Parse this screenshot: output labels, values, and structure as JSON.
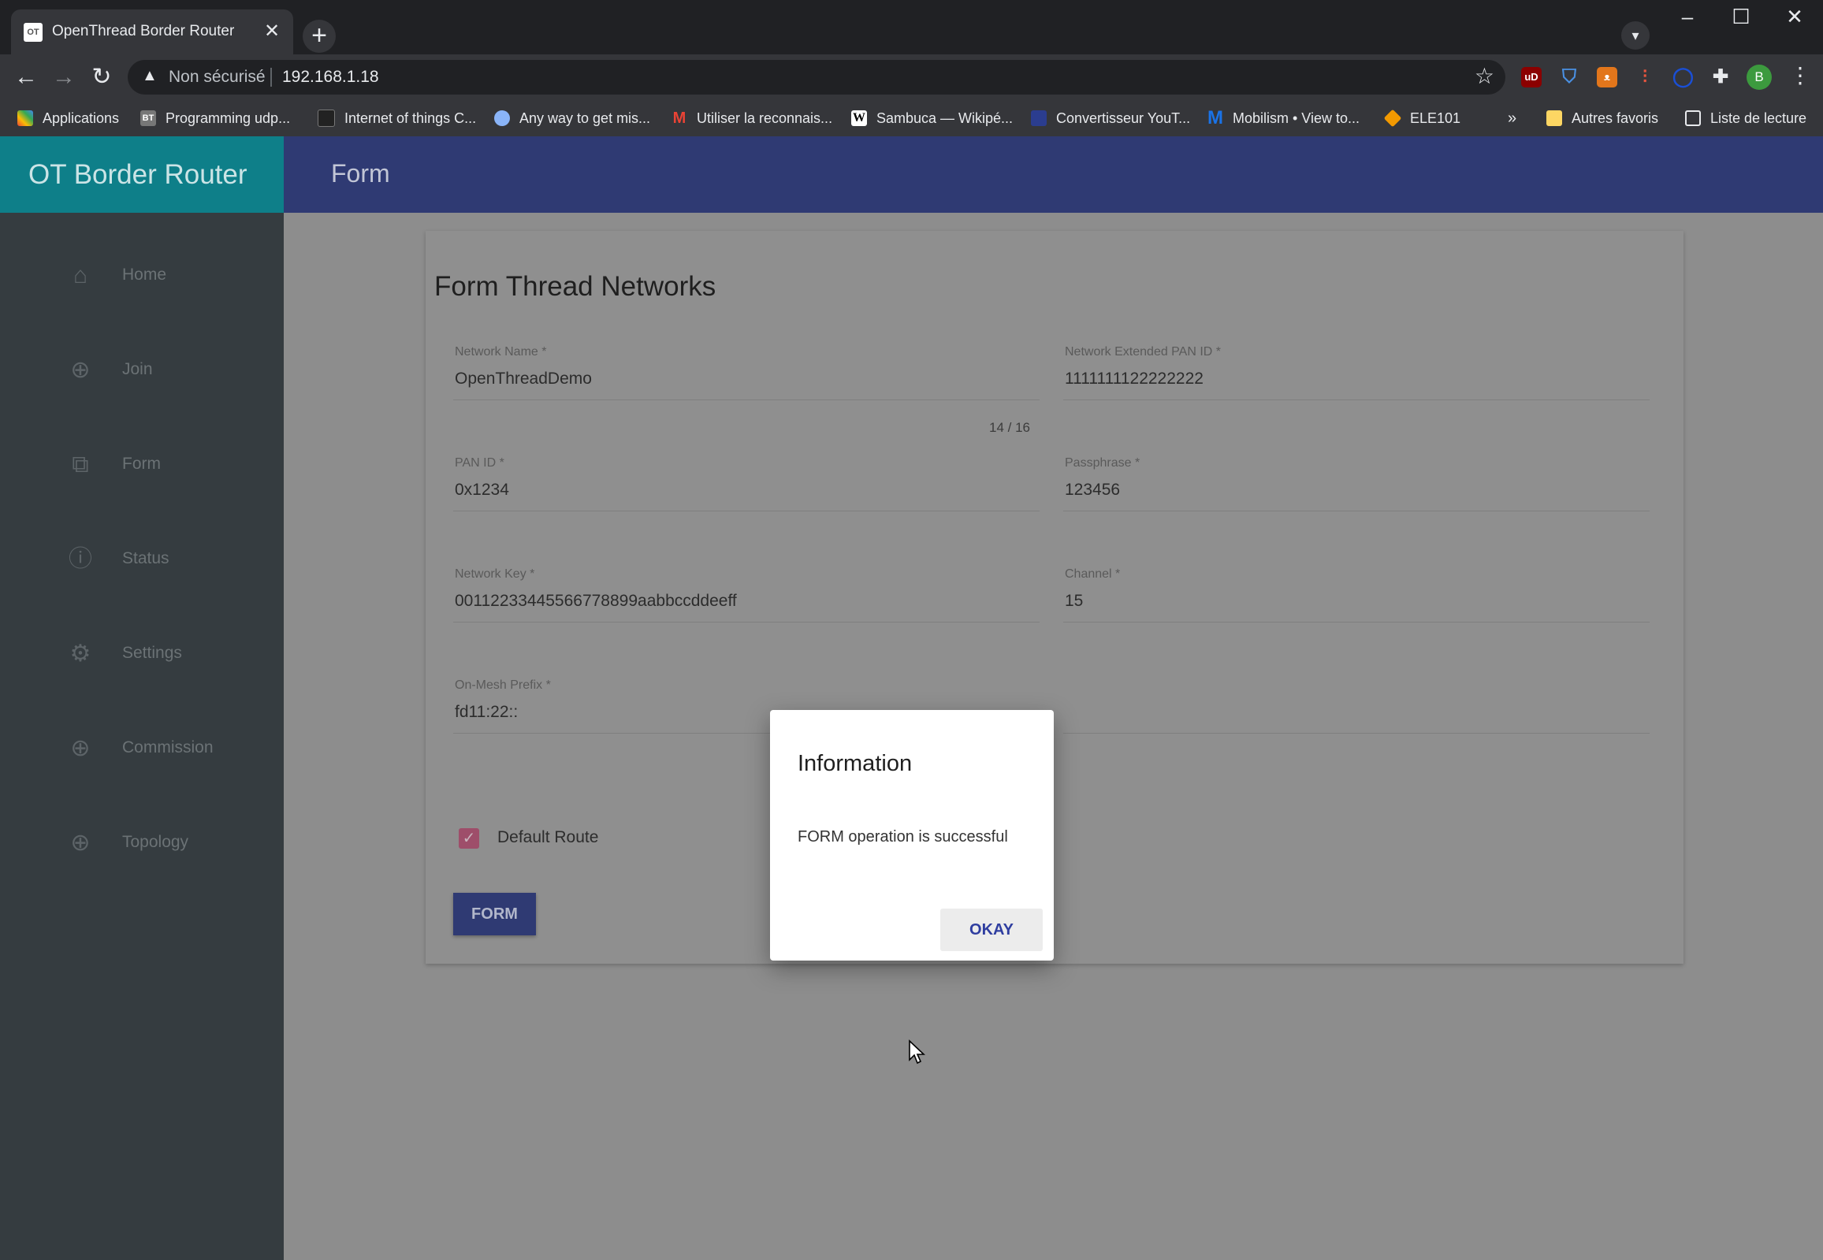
{
  "browser": {
    "tab": {
      "favicon_text": "OT",
      "title": "OpenThread Border Router",
      "close": "✕"
    },
    "new_tab": "+",
    "window_controls": {
      "minimize": "–",
      "maximize": "☐",
      "close": "✕"
    },
    "nav": {
      "back": "←",
      "forward": "→",
      "reload": "↻"
    },
    "address": {
      "security_label": "Non sécurisé",
      "url": "192.168.1.18"
    },
    "profile_initial": "B",
    "extensions": [
      "ublock-icon",
      "shield-icon",
      "fox-icon",
      "chart-icon",
      "circle-icon",
      "puzzle-icon"
    ],
    "bookmarks": [
      {
        "label": "Applications",
        "icon": "apps-grid-icon",
        "color": "#4285f4"
      },
      {
        "label": "Programming udp...",
        "icon": "bt-icon",
        "color": "#777777",
        "text": "BT"
      },
      {
        "label": "Internet of things C...",
        "icon": "iot-icon",
        "color": "#222222"
      },
      {
        "label": "Any way to get mis...",
        "icon": "globe-icon",
        "color": "#8ab4f8"
      },
      {
        "label": "Utiliser la reconnais...",
        "icon": "gmail-icon",
        "color": "#ea4335",
        "text": "M"
      },
      {
        "label": "Sambuca — Wikipé...",
        "icon": "wikipedia-icon",
        "color": "#ffffff",
        "text": "W"
      },
      {
        "label": "Convertisseur YouT...",
        "icon": "converter-icon",
        "color": "#2b3d8f"
      },
      {
        "label": "Mobilism • View to...",
        "icon": "mobilism-icon",
        "color": "#1a73e8",
        "text": "M"
      },
      {
        "label": "ELE101",
        "icon": "diamond-icon",
        "color": "#f29900"
      }
    ],
    "bookmarks_overflow": "»",
    "other_bookmarks": "Autres favoris",
    "reading_list": "Liste de lecture"
  },
  "app": {
    "brand": "OT Border Router",
    "page_title": "Form",
    "nav": [
      {
        "label": "Home",
        "icon": "home-icon",
        "glyph": "⌂"
      },
      {
        "label": "Join",
        "icon": "add-circle-icon",
        "glyph": "⊕"
      },
      {
        "label": "Form",
        "icon": "open-in-new-icon",
        "glyph": "⧉"
      },
      {
        "label": "Status",
        "icon": "info-icon",
        "glyph": "ⓘ"
      },
      {
        "label": "Settings",
        "icon": "gear-icon",
        "glyph": "⚙"
      },
      {
        "label": "Commission",
        "icon": "add-circle-icon",
        "glyph": "⊕"
      },
      {
        "label": "Topology",
        "icon": "add-circle-icon",
        "glyph": "⊕"
      }
    ],
    "form": {
      "title": "Form Thread Networks",
      "network_name": {
        "label": "Network Name *",
        "value": "OpenThreadDemo",
        "counter": "14 / 16"
      },
      "ext_pan_id": {
        "label": "Network Extended PAN ID *",
        "value": "1111111122222222"
      },
      "pan_id": {
        "label": "PAN ID *",
        "value": "0x1234"
      },
      "passphrase": {
        "label": "Passphrase *",
        "value": "123456"
      },
      "network_key": {
        "label": "Network Key *",
        "value": "00112233445566778899aabbccddeeff"
      },
      "channel": {
        "label": "Channel *",
        "value": "15"
      },
      "on_mesh_prefix": {
        "label": "On-Mesh Prefix *",
        "value": "fd11:22::"
      },
      "default_route": {
        "label": "Default Route",
        "checked": true
      },
      "submit_label": "FORM"
    },
    "dialog": {
      "title": "Information",
      "message": "FORM operation is successful",
      "ok_label": "OKAY"
    }
  },
  "colors": {
    "brand_bg": "#0e7f89",
    "header_bg": "#2f3a73",
    "sidebar_bg": "#353c40",
    "checkbox": "#9e4e6a",
    "dialog_button_text": "#2f3ea0"
  }
}
